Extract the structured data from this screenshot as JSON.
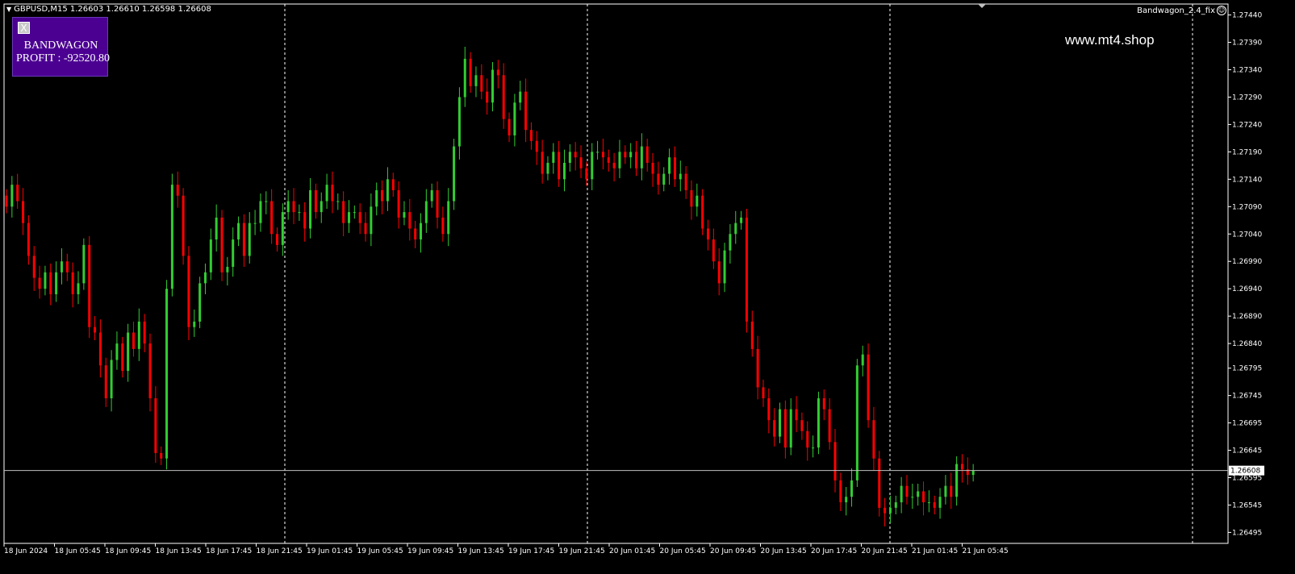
{
  "header": {
    "symbol_info": "GBPUSD,M15  1.26603 1.26610 1.26598 1.26608",
    "indicator": "Bandwagon_2.4_fix"
  },
  "watermark": "www.mt4.shop",
  "panel": {
    "close_label": "X",
    "title": "BANDWAGON",
    "profit": "PROFIT : -92520.80",
    "background": "#4b0092"
  },
  "colors": {
    "bull": "#32cd32",
    "bear": "#ff0000",
    "background": "#000000",
    "axis": "#ffffff",
    "bid_line": "#c0c0c0"
  },
  "chart_data": {
    "type": "candlestick",
    "symbol": "GBPUSD",
    "timeframe": "M15",
    "ylim": [
      1.26475,
      1.2746
    ],
    "y_ticks": [
      "1.27440",
      "1.27390",
      "1.27340",
      "1.27290",
      "1.27240",
      "1.27190",
      "1.27140",
      "1.27090",
      "1.27040",
      "1.26990",
      "1.26940",
      "1.26890",
      "1.26840",
      "1.26795",
      "1.26745",
      "1.26695",
      "1.26645",
      "1.26595",
      "1.26545",
      "1.26495"
    ],
    "x_ticks": [
      "18 Jun 2024",
      "18 Jun 05:45",
      "18 Jun 09:45",
      "18 Jun 13:45",
      "18 Jun 17:45",
      "18 Jun 21:45",
      "19 Jun 01:45",
      "19 Jun 05:45",
      "19 Jun 09:45",
      "19 Jun 13:45",
      "19 Jun 17:45",
      "19 Jun 21:45",
      "20 Jun 01:45",
      "20 Jun 05:45",
      "20 Jun 09:45",
      "20 Jun 13:45",
      "20 Jun 17:45",
      "20 Jun 21:45",
      "21 Jun 01:45",
      "21 Jun 05:45"
    ],
    "bid_price": "1.26608",
    "closes": [
      1.2709,
      1.2713,
      1.271,
      1.2706,
      1.27,
      1.2696,
      1.2694,
      1.2697,
      1.2693,
      1.2697,
      1.2699,
      1.2697,
      1.2693,
      1.2695,
      1.2702,
      1.2687,
      1.2686,
      1.268,
      1.2674,
      1.2681,
      1.2684,
      1.2679,
      1.2686,
      1.2683,
      1.2688,
      1.2684,
      1.2674,
      1.2664,
      1.2663,
      1.2694,
      1.2713,
      1.2711,
      1.27,
      1.2687,
      1.2688,
      1.2695,
      1.2697,
      1.2703,
      1.2707,
      1.2697,
      1.2698,
      1.2703,
      1.2706,
      1.27,
      1.2706,
      1.2706,
      1.271,
      1.271,
      1.2704,
      1.2702,
      1.2708,
      1.271,
      1.2708,
      1.2708,
      1.2705,
      1.2712,
      1.2708,
      1.271,
      1.2713,
      1.271,
      1.271,
      1.2706,
      1.2708,
      1.2708,
      1.2706,
      1.2704,
      1.2709,
      1.2712,
      1.271,
      1.2714,
      1.2712,
      1.2707,
      1.2708,
      1.2705,
      1.2703,
      1.2706,
      1.271,
      1.2712,
      1.2707,
      1.2704,
      1.271,
      1.272,
      1.2729,
      1.2736,
      1.2731,
      1.2733,
      1.273,
      1.2728,
      1.2734,
      1.2733,
      1.2725,
      1.2722,
      1.2728,
      1.273,
      1.2723,
      1.2721,
      1.2719,
      1.2715,
      1.2717,
      1.2719,
      1.2714,
      1.2717,
      1.2719,
      1.2718,
      1.2716,
      1.2714,
      1.2719,
      1.2719,
      1.2718,
      1.2717,
      1.2716,
      1.2719,
      1.2718,
      1.2719,
      1.2716,
      1.272,
      1.2717,
      1.2715,
      1.2713,
      1.2715,
      1.2718,
      1.2714,
      1.2715,
      1.2712,
      1.2709,
      1.2711,
      1.2705,
      1.2703,
      1.2699,
      1.2695,
      1.2701,
      1.2704,
      1.2706,
      1.2707,
      1.2688,
      1.2683,
      1.2676,
      1.2674,
      1.267,
      1.2667,
      1.2672,
      1.2665,
      1.2672,
      1.267,
      1.2668,
      1.2665,
      1.2665,
      1.2674,
      1.2672,
      1.2666,
      1.2659,
      1.2655,
      1.2656,
      1.2659,
      1.268,
      1.2682,
      1.267,
      1.2663,
      1.2654,
      1.2653,
      1.2654,
      1.2655,
      1.2658,
      1.2656,
      1.2656,
      1.2657,
      1.2655,
      1.2655,
      1.2654,
      1.2656,
      1.2658,
      1.2656,
      1.2662,
      1.2661,
      1.266,
      1.26608
    ]
  }
}
